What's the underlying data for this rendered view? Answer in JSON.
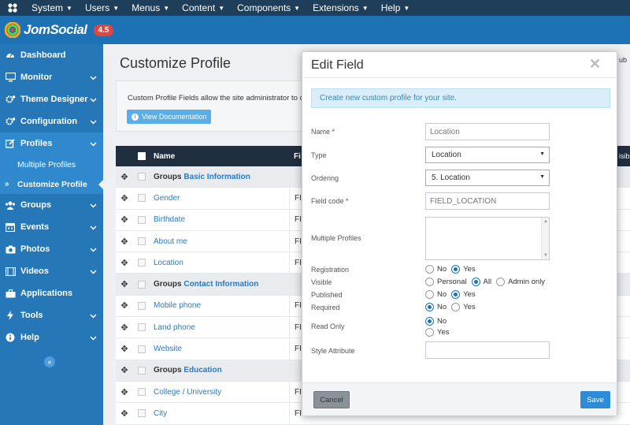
{
  "topmenu": {
    "items": [
      "System",
      "Users",
      "Menus",
      "Content",
      "Components",
      "Extensions",
      "Help"
    ]
  },
  "brand": {
    "name": "JomSocial",
    "version": "4.5"
  },
  "sidebar": {
    "items": [
      {
        "label": "Dashboard",
        "icon": "dashboard-icon"
      },
      {
        "label": "Monitor",
        "icon": "monitor-icon"
      },
      {
        "label": "Theme Designer",
        "icon": "cogs-icon"
      },
      {
        "label": "Configuration",
        "icon": "cogs-icon"
      },
      {
        "label": "Profiles",
        "icon": "edit-icon"
      },
      {
        "label": "Groups",
        "icon": "users-icon"
      },
      {
        "label": "Events",
        "icon": "calendar-icon"
      },
      {
        "label": "Photos",
        "icon": "camera-icon"
      },
      {
        "label": "Videos",
        "icon": "film-icon"
      },
      {
        "label": "Applications",
        "icon": "briefcase-icon"
      },
      {
        "label": "Tools",
        "icon": "bolt-icon"
      },
      {
        "label": "Help",
        "icon": "info-icon"
      }
    ],
    "profiles_sub": [
      "Multiple Profiles",
      "Customize Profile"
    ]
  },
  "main": {
    "title": "Customize Profile",
    "description": "Custom Profile Fields allow the site administrator to cr",
    "view_doc": "View Documentation",
    "table_header": {
      "name": "Name",
      "fi": "Fi"
    },
    "right_labels": {
      "pub": "ub",
      "visi": "isib"
    },
    "rows": [
      {
        "type": "group",
        "prefix": "Groups",
        "name": "Basic Information"
      },
      {
        "type": "field",
        "name": "Gender",
        "fi": "FI"
      },
      {
        "type": "field",
        "name": "Birthdate",
        "fi": "FI"
      },
      {
        "type": "field",
        "name": "About me",
        "fi": "FI"
      },
      {
        "type": "field",
        "name": "Location",
        "fi": "FI"
      },
      {
        "type": "group",
        "prefix": "Groups",
        "name": "Contact Information"
      },
      {
        "type": "field",
        "name": "Mobile phone",
        "fi": "FI"
      },
      {
        "type": "field",
        "name": "Land phone",
        "fi": "FI"
      },
      {
        "type": "field",
        "name": "Website",
        "fi": "FI"
      },
      {
        "type": "group",
        "prefix": "Groups",
        "name": "Education"
      },
      {
        "type": "field",
        "name": "College / University",
        "fi": "FI"
      },
      {
        "type": "field",
        "name": "City",
        "fi": "FI"
      }
    ]
  },
  "modal": {
    "title": "Edit Field",
    "info": "Create new custom profile for your site.",
    "labels": {
      "name": "Name *",
      "type": "Type",
      "ordering": "Ordering",
      "field_code": "Field code *",
      "multiple_profiles": "Multiple Profiles",
      "registration": "Registration",
      "visible": "Visible",
      "published": "Published",
      "required": "Required",
      "read_only": "Read Only",
      "style_attribute": "Style Attribute"
    },
    "values": {
      "name": "Location",
      "type": "Location",
      "ordering": "5. Location",
      "field_code": "FIELD_LOCATION",
      "style_attribute": ""
    },
    "radio": {
      "no": "No",
      "yes": "Yes",
      "personal": "Personal",
      "all": "All",
      "admin_only": "Admin only"
    },
    "cancel": "Cancel",
    "save": "Save"
  }
}
